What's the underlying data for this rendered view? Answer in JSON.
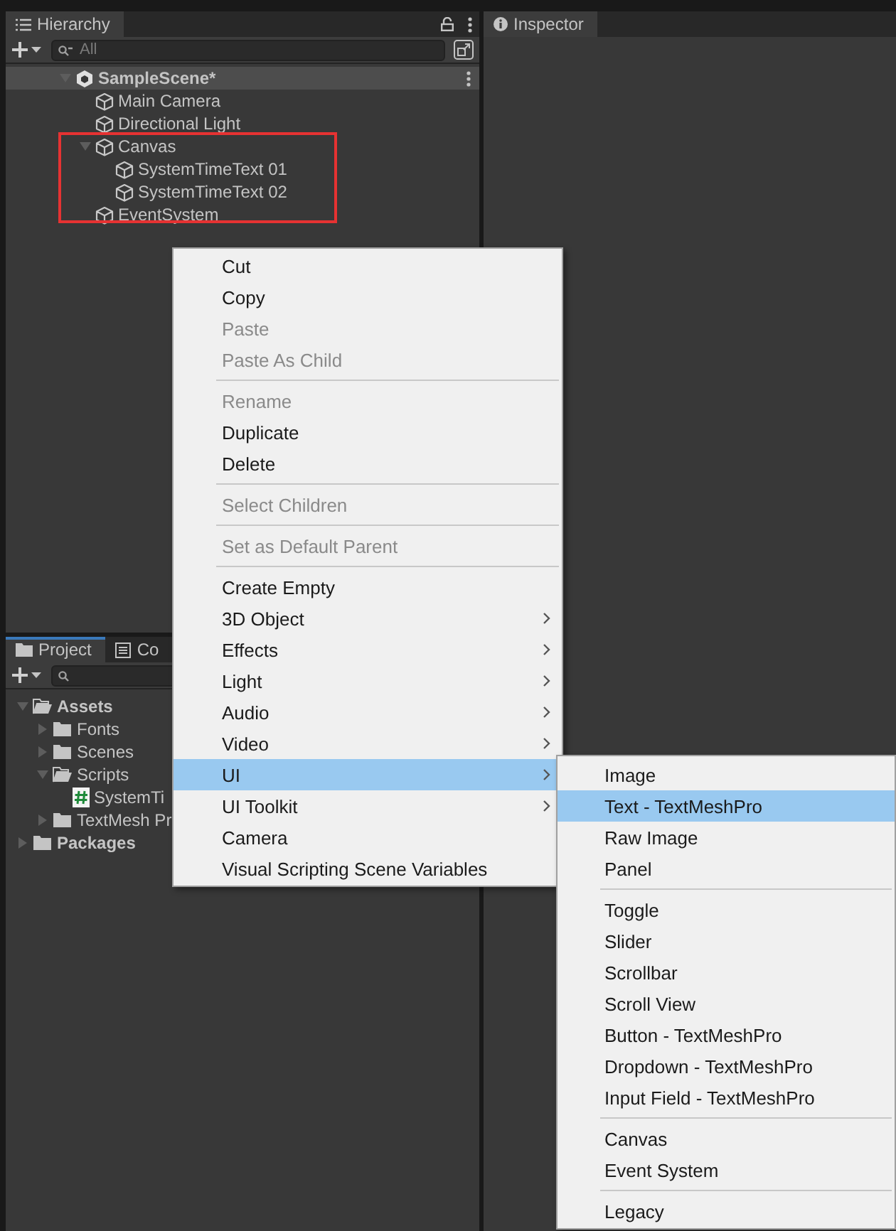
{
  "hierarchy": {
    "tab": "Hierarchy",
    "search": {
      "placeholder": "All"
    },
    "tree": [
      {
        "name": "SampleScene*",
        "kind": "scene",
        "expanded": true,
        "children": [
          {
            "name": "Main Camera",
            "kind": "object"
          },
          {
            "name": "Directional Light",
            "kind": "object"
          },
          {
            "name": "Canvas",
            "kind": "object",
            "expanded": true,
            "children": [
              {
                "name": "SystemTimeText 01",
                "kind": "object"
              },
              {
                "name": "SystemTimeText 02",
                "kind": "object"
              }
            ]
          },
          {
            "name": "EventSystem",
            "kind": "object"
          }
        ]
      }
    ]
  },
  "project": {
    "tabs": [
      {
        "label": "Project",
        "selected": true
      },
      {
        "label": "Co",
        "selected": false
      }
    ],
    "tree": [
      {
        "name": "Assets",
        "kind": "folder",
        "expanded": true,
        "children": [
          {
            "name": "Fonts",
            "kind": "folder",
            "expanded": false
          },
          {
            "name": "Scenes",
            "kind": "folder",
            "expanded": false
          },
          {
            "name": "Scripts",
            "kind": "folder",
            "expanded": true,
            "children": [
              {
                "name": "SystemTi",
                "kind": "script"
              }
            ]
          },
          {
            "name": "TextMesh Pr",
            "kind": "folder",
            "expanded": false
          }
        ]
      },
      {
        "name": "Packages",
        "kind": "folder",
        "expanded": false
      }
    ]
  },
  "inspector": {
    "tab": "Inspector"
  },
  "context_menu": {
    "items": [
      {
        "kind": "item",
        "label": "Cut",
        "disabled": false,
        "submenu": false,
        "selected": false
      },
      {
        "kind": "item",
        "label": "Copy",
        "disabled": false,
        "submenu": false,
        "selected": false
      },
      {
        "kind": "item",
        "label": "Paste",
        "disabled": true,
        "submenu": false,
        "selected": false
      },
      {
        "kind": "item",
        "label": "Paste As Child",
        "disabled": true,
        "submenu": false,
        "selected": false
      },
      {
        "kind": "separator"
      },
      {
        "kind": "item",
        "label": "Rename",
        "disabled": true,
        "submenu": false,
        "selected": false
      },
      {
        "kind": "item",
        "label": "Duplicate",
        "disabled": false,
        "submenu": false,
        "selected": false
      },
      {
        "kind": "item",
        "label": "Delete",
        "disabled": false,
        "submenu": false,
        "selected": false
      },
      {
        "kind": "separator"
      },
      {
        "kind": "item",
        "label": "Select Children",
        "disabled": true,
        "submenu": false,
        "selected": false
      },
      {
        "kind": "separator"
      },
      {
        "kind": "item",
        "label": "Set as Default Parent",
        "disabled": true,
        "submenu": false,
        "selected": false
      },
      {
        "kind": "separator"
      },
      {
        "kind": "item",
        "label": "Create Empty",
        "disabled": false,
        "submenu": false,
        "selected": false
      },
      {
        "kind": "item",
        "label": "3D Object",
        "disabled": false,
        "submenu": true,
        "selected": false
      },
      {
        "kind": "item",
        "label": "Effects",
        "disabled": false,
        "submenu": true,
        "selected": false
      },
      {
        "kind": "item",
        "label": "Light",
        "disabled": false,
        "submenu": true,
        "selected": false
      },
      {
        "kind": "item",
        "label": "Audio",
        "disabled": false,
        "submenu": true,
        "selected": false
      },
      {
        "kind": "item",
        "label": "Video",
        "disabled": false,
        "submenu": true,
        "selected": false
      },
      {
        "kind": "item",
        "label": "UI",
        "disabled": false,
        "submenu": true,
        "selected": true
      },
      {
        "kind": "item",
        "label": "UI Toolkit",
        "disabled": false,
        "submenu": true,
        "selected": false
      },
      {
        "kind": "item",
        "label": "Camera",
        "disabled": false,
        "submenu": false,
        "selected": false
      },
      {
        "kind": "item",
        "label": "Visual Scripting Scene Variables",
        "disabled": false,
        "submenu": false,
        "selected": false
      }
    ]
  },
  "submenu": {
    "items": [
      {
        "kind": "item",
        "label": "Image",
        "disabled": false,
        "submenu": false,
        "selected": false
      },
      {
        "kind": "item",
        "label": "Text - TextMeshPro",
        "disabled": false,
        "submenu": false,
        "selected": true
      },
      {
        "kind": "item",
        "label": "Raw Image",
        "disabled": false,
        "submenu": false,
        "selected": false
      },
      {
        "kind": "item",
        "label": "Panel",
        "disabled": false,
        "submenu": false,
        "selected": false
      },
      {
        "kind": "separator"
      },
      {
        "kind": "item",
        "label": "Toggle",
        "disabled": false,
        "submenu": false,
        "selected": false
      },
      {
        "kind": "item",
        "label": "Slider",
        "disabled": false,
        "submenu": false,
        "selected": false
      },
      {
        "kind": "item",
        "label": "Scrollbar",
        "disabled": false,
        "submenu": false,
        "selected": false
      },
      {
        "kind": "item",
        "label": "Scroll View",
        "disabled": false,
        "submenu": false,
        "selected": false
      },
      {
        "kind": "item",
        "label": "Button - TextMeshPro",
        "disabled": false,
        "submenu": false,
        "selected": false
      },
      {
        "kind": "item",
        "label": "Dropdown - TextMeshPro",
        "disabled": false,
        "submenu": false,
        "selected": false
      },
      {
        "kind": "item",
        "label": "Input Field - TextMeshPro",
        "disabled": false,
        "submenu": false,
        "selected": false
      },
      {
        "kind": "separator"
      },
      {
        "kind": "item",
        "label": "Canvas",
        "disabled": false,
        "submenu": false,
        "selected": false
      },
      {
        "kind": "item",
        "label": "Event System",
        "disabled": false,
        "submenu": false,
        "selected": false
      },
      {
        "kind": "separator"
      },
      {
        "kind": "item",
        "label": "Legacy",
        "disabled": false,
        "submenu": false,
        "selected": false
      }
    ]
  }
}
